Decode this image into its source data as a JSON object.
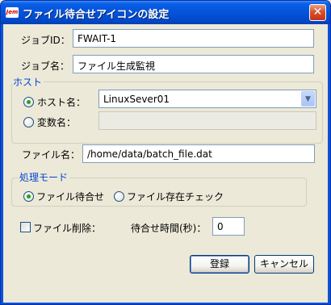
{
  "window": {
    "icon_text": "Jem",
    "title": "ファイル待合せアイコンの設定",
    "close_icon": "close-icon"
  },
  "job_id": {
    "label": "ジョブID：",
    "value": "FWAIT-1"
  },
  "job_name": {
    "label": "ジョブ名：",
    "value": "ファイル生成監視"
  },
  "host_group": {
    "title": "ホスト",
    "host_option": {
      "label": "ホスト名：",
      "checked": true
    },
    "host_select": {
      "value": "LinuxSever01"
    },
    "variable_option": {
      "label": "変数名：",
      "checked": false
    },
    "variable_input": {
      "value": ""
    }
  },
  "file_name": {
    "label": "ファイル名：",
    "value": "/home/data/batch_file.dat"
  },
  "mode_group": {
    "title": "処理モード",
    "options": [
      {
        "label": "ファイル待合せ",
        "checked": true
      },
      {
        "label": "ファイル存在チェック",
        "checked": false
      }
    ]
  },
  "file_delete": {
    "label": "ファイル削除：",
    "checked": false
  },
  "wait_time": {
    "label": "待合せ時間(秒)：",
    "value": "0"
  },
  "buttons": {
    "register": "登録",
    "cancel": "キャンセル"
  }
}
